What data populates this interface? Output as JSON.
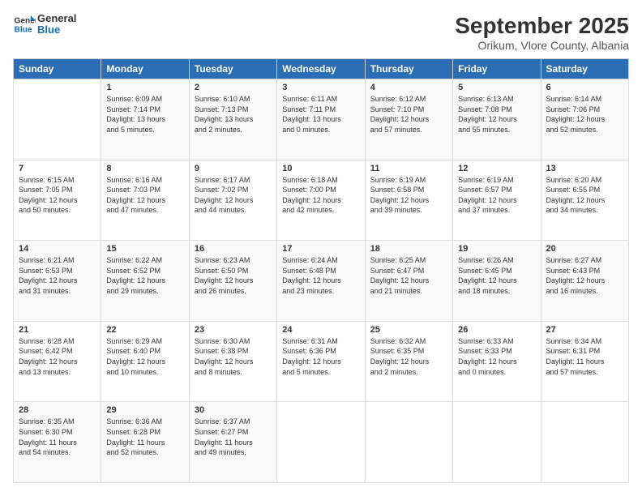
{
  "logo": {
    "line1": "General",
    "line2": "Blue"
  },
  "title": "September 2025",
  "location": "Orikum, Vlore County, Albania",
  "days_header": [
    "Sunday",
    "Monday",
    "Tuesday",
    "Wednesday",
    "Thursday",
    "Friday",
    "Saturday"
  ],
  "weeks": [
    [
      {
        "day": "",
        "info": ""
      },
      {
        "day": "1",
        "info": "Sunrise: 6:09 AM\nSunset: 7:14 PM\nDaylight: 13 hours\nand 5 minutes."
      },
      {
        "day": "2",
        "info": "Sunrise: 6:10 AM\nSunset: 7:13 PM\nDaylight: 13 hours\nand 2 minutes."
      },
      {
        "day": "3",
        "info": "Sunrise: 6:11 AM\nSunset: 7:11 PM\nDaylight: 13 hours\nand 0 minutes."
      },
      {
        "day": "4",
        "info": "Sunrise: 6:12 AM\nSunset: 7:10 PM\nDaylight: 12 hours\nand 57 minutes."
      },
      {
        "day": "5",
        "info": "Sunrise: 6:13 AM\nSunset: 7:08 PM\nDaylight: 12 hours\nand 55 minutes."
      },
      {
        "day": "6",
        "info": "Sunrise: 6:14 AM\nSunset: 7:06 PM\nDaylight: 12 hours\nand 52 minutes."
      }
    ],
    [
      {
        "day": "7",
        "info": "Sunrise: 6:15 AM\nSunset: 7:05 PM\nDaylight: 12 hours\nand 50 minutes."
      },
      {
        "day": "8",
        "info": "Sunrise: 6:16 AM\nSunset: 7:03 PM\nDaylight: 12 hours\nand 47 minutes."
      },
      {
        "day": "9",
        "info": "Sunrise: 6:17 AM\nSunset: 7:02 PM\nDaylight: 12 hours\nand 44 minutes."
      },
      {
        "day": "10",
        "info": "Sunrise: 6:18 AM\nSunset: 7:00 PM\nDaylight: 12 hours\nand 42 minutes."
      },
      {
        "day": "11",
        "info": "Sunrise: 6:19 AM\nSunset: 6:58 PM\nDaylight: 12 hours\nand 39 minutes."
      },
      {
        "day": "12",
        "info": "Sunrise: 6:19 AM\nSunset: 6:57 PM\nDaylight: 12 hours\nand 37 minutes."
      },
      {
        "day": "13",
        "info": "Sunrise: 6:20 AM\nSunset: 6:55 PM\nDaylight: 12 hours\nand 34 minutes."
      }
    ],
    [
      {
        "day": "14",
        "info": "Sunrise: 6:21 AM\nSunset: 6:53 PM\nDaylight: 12 hours\nand 31 minutes."
      },
      {
        "day": "15",
        "info": "Sunrise: 6:22 AM\nSunset: 6:52 PM\nDaylight: 12 hours\nand 29 minutes."
      },
      {
        "day": "16",
        "info": "Sunrise: 6:23 AM\nSunset: 6:50 PM\nDaylight: 12 hours\nand 26 minutes."
      },
      {
        "day": "17",
        "info": "Sunrise: 6:24 AM\nSunset: 6:48 PM\nDaylight: 12 hours\nand 23 minutes."
      },
      {
        "day": "18",
        "info": "Sunrise: 6:25 AM\nSunset: 6:47 PM\nDaylight: 12 hours\nand 21 minutes."
      },
      {
        "day": "19",
        "info": "Sunrise: 6:26 AM\nSunset: 6:45 PM\nDaylight: 12 hours\nand 18 minutes."
      },
      {
        "day": "20",
        "info": "Sunrise: 6:27 AM\nSunset: 6:43 PM\nDaylight: 12 hours\nand 16 minutes."
      }
    ],
    [
      {
        "day": "21",
        "info": "Sunrise: 6:28 AM\nSunset: 6:42 PM\nDaylight: 12 hours\nand 13 minutes."
      },
      {
        "day": "22",
        "info": "Sunrise: 6:29 AM\nSunset: 6:40 PM\nDaylight: 12 hours\nand 10 minutes."
      },
      {
        "day": "23",
        "info": "Sunrise: 6:30 AM\nSunset: 6:38 PM\nDaylight: 12 hours\nand 8 minutes."
      },
      {
        "day": "24",
        "info": "Sunrise: 6:31 AM\nSunset: 6:36 PM\nDaylight: 12 hours\nand 5 minutes."
      },
      {
        "day": "25",
        "info": "Sunrise: 6:32 AM\nSunset: 6:35 PM\nDaylight: 12 hours\nand 2 minutes."
      },
      {
        "day": "26",
        "info": "Sunrise: 6:33 AM\nSunset: 6:33 PM\nDaylight: 12 hours\nand 0 minutes."
      },
      {
        "day": "27",
        "info": "Sunrise: 6:34 AM\nSunset: 6:31 PM\nDaylight: 11 hours\nand 57 minutes."
      }
    ],
    [
      {
        "day": "28",
        "info": "Sunrise: 6:35 AM\nSunset: 6:30 PM\nDaylight: 11 hours\nand 54 minutes."
      },
      {
        "day": "29",
        "info": "Sunrise: 6:36 AM\nSunset: 6:28 PM\nDaylight: 11 hours\nand 52 minutes."
      },
      {
        "day": "30",
        "info": "Sunrise: 6:37 AM\nSunset: 6:27 PM\nDaylight: 11 hours\nand 49 minutes."
      },
      {
        "day": "",
        "info": ""
      },
      {
        "day": "",
        "info": ""
      },
      {
        "day": "",
        "info": ""
      },
      {
        "day": "",
        "info": ""
      }
    ]
  ]
}
